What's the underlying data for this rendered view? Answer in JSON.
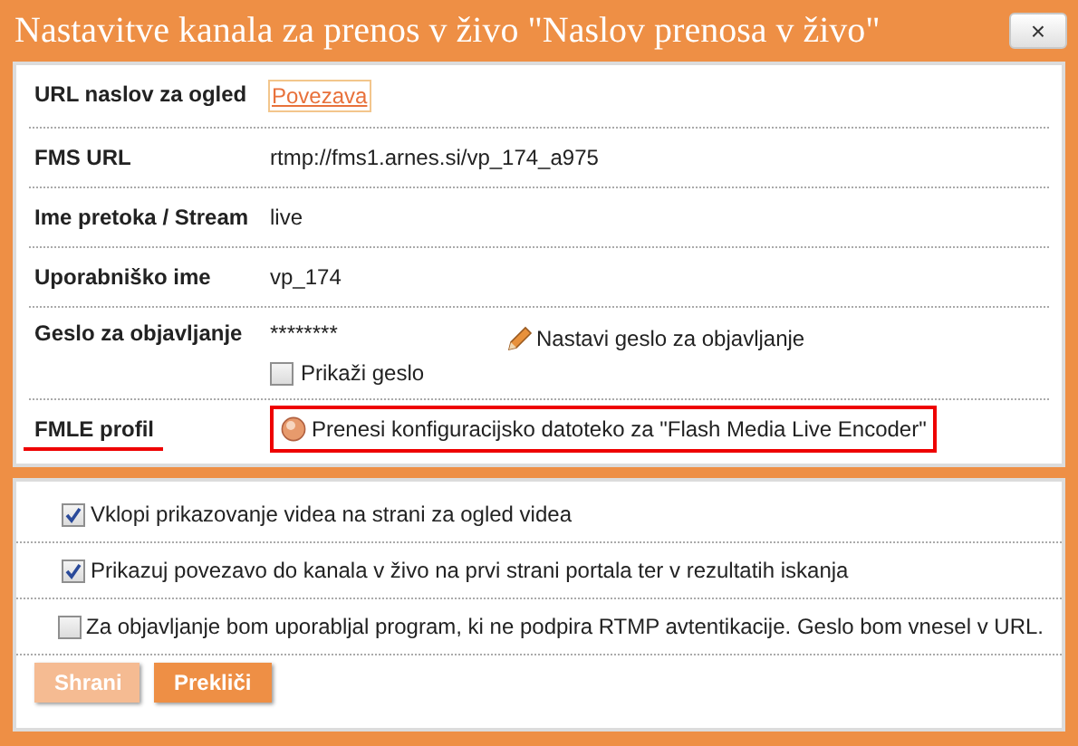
{
  "window": {
    "title": "Nastavitve kanala za prenos v živo \"Naslov prenosa v živo\"",
    "close": "×"
  },
  "fields": [
    {
      "label": "URL naslov za ogled",
      "kind": "link",
      "value": "Povezava",
      "highlighted": false
    },
    {
      "label": "FMS URL",
      "kind": "text",
      "value": "rtmp://fms1.arnes.si/vp_174_a975",
      "highlighted": false
    },
    {
      "label": "Ime pretoka / Stream",
      "kind": "text",
      "value": "live",
      "highlighted": false
    },
    {
      "label": "Uporabniško ime",
      "kind": "text",
      "value": "vp_174",
      "highlighted": false
    },
    {
      "label": "Geslo za objavljanje",
      "kind": "password",
      "value": "********",
      "action": "Nastavi geslo za objavljanje",
      "checkbox": {
        "label": "Prikaži geslo",
        "checked": false
      },
      "highlighted": false
    },
    {
      "label": "FMLE profil",
      "kind": "download",
      "value": "Prenesi konfiguracijsko datoteko za \"Flash Media Live Encoder\"",
      "highlighted": true
    }
  ],
  "options": [
    {
      "label": "Vklopi prikazovanje videa na strani za ogled videa",
      "checked": true
    },
    {
      "label": "Prikazuj povezavo do kanala v živo na prvi strani portala ter v rezultatih iskanja",
      "checked": true
    },
    {
      "label": "Za objavljanje bom uporabljal program, ki ne podpira RTMP avtentikacije. Geslo bom vnesel v URL.",
      "checked": false
    }
  ],
  "buttons": [
    {
      "label": "Shrani",
      "disabled": true
    },
    {
      "label": "Prekliči",
      "disabled": false
    }
  ]
}
